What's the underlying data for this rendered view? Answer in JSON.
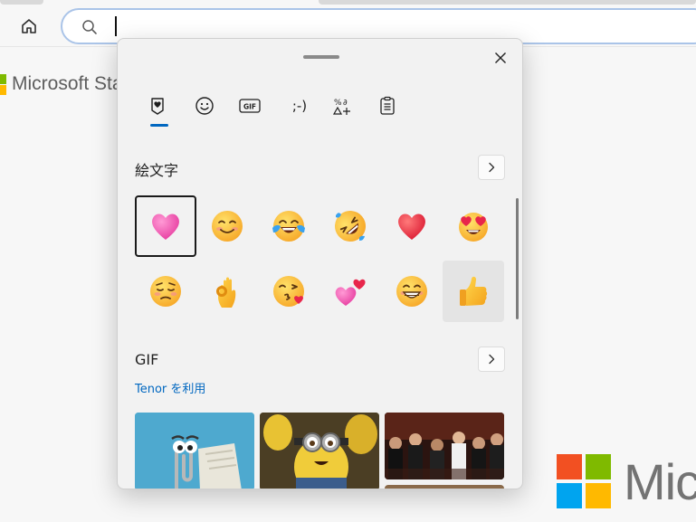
{
  "browser": {
    "home_icon": "home-icon",
    "search_icon": "search-icon",
    "address_value": ""
  },
  "page": {
    "brand_text": "Microsoft Sta",
    "brand_text_big": "Mic",
    "logo_colors": [
      "#f25022",
      "#7fba00",
      "#00a4ef",
      "#ffb900"
    ]
  },
  "emoji_panel": {
    "close_icon": "close-icon",
    "tabs": [
      {
        "name": "recent-heart",
        "label": "",
        "icon": "heart-in-box-icon",
        "active": true
      },
      {
        "name": "emoji",
        "label": "",
        "icon": "smiley-icon",
        "active": false
      },
      {
        "name": "gif",
        "label": "GIF",
        "icon": "gif-icon",
        "active": false
      },
      {
        "name": "kaomoji",
        "label": ";-)",
        "icon": "kaomoji-icon",
        "active": false
      },
      {
        "name": "symbols",
        "label": "",
        "icon": "symbols-icon",
        "active": false
      },
      {
        "name": "clipboard",
        "label": "",
        "icon": "clipboard-icon",
        "active": false
      }
    ],
    "emoji_section": {
      "title": "絵文字",
      "more_icon": "chevron-right-icon",
      "items": [
        {
          "name": "pink-heart",
          "state": "selected"
        },
        {
          "name": "smiling-face",
          "state": ""
        },
        {
          "name": "face-with-tears-of-joy",
          "state": ""
        },
        {
          "name": "rolling-on-the-floor-laughing",
          "state": ""
        },
        {
          "name": "red-heart",
          "state": ""
        },
        {
          "name": "smiling-face-with-heart-eyes",
          "state": ""
        },
        {
          "name": "pensive-face",
          "state": ""
        },
        {
          "name": "ok-hand",
          "state": ""
        },
        {
          "name": "face-blowing-a-kiss",
          "state": ""
        },
        {
          "name": "two-hearts",
          "state": ""
        },
        {
          "name": "beaming-face",
          "state": ""
        },
        {
          "name": "thumbs-up",
          "state": "hover"
        }
      ]
    },
    "gif_section": {
      "title": "GIF",
      "more_icon": "chevron-right-icon",
      "provider_text": "Tenor を利用"
    },
    "accent_color": "#0067c0"
  }
}
